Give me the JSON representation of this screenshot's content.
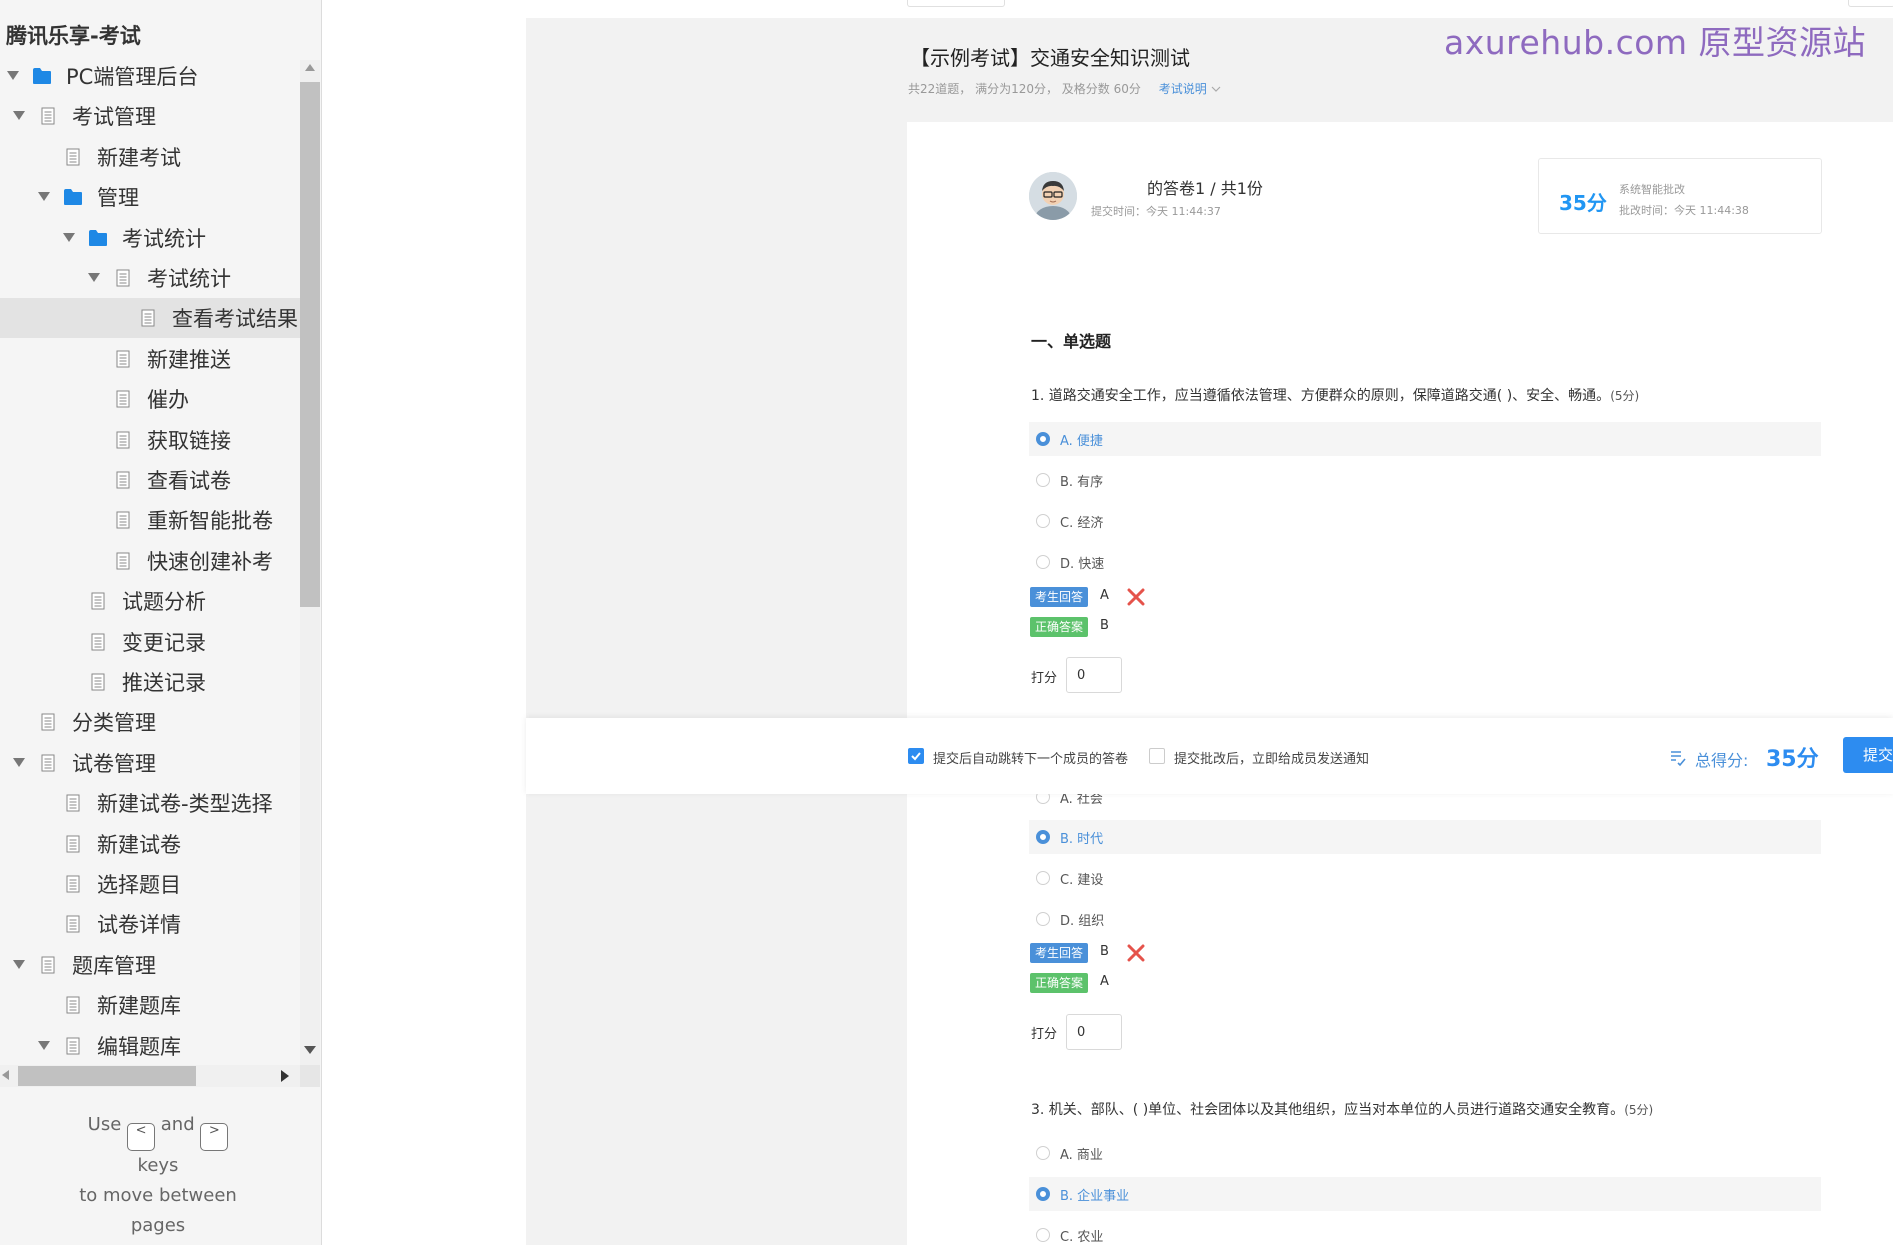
{
  "sidebar": {
    "title": "腾讯乐享-考试",
    "tree": [
      {
        "label": "PC端管理后台",
        "level": 0,
        "type": "folder",
        "expanded": true
      },
      {
        "label": "考试管理",
        "level": 1,
        "type": "page",
        "expanded": true
      },
      {
        "label": "新建考试",
        "level": 2,
        "type": "page"
      },
      {
        "label": "管理",
        "level": 2,
        "type": "folder",
        "expanded": true
      },
      {
        "label": "考试统计",
        "level": 3,
        "type": "folder",
        "expanded": true
      },
      {
        "label": "考试统计",
        "level": 4,
        "type": "page",
        "expanded": true
      },
      {
        "label": "查看考试结果",
        "level": 5,
        "type": "page",
        "selected": true
      },
      {
        "label": "新建推送",
        "level": 4,
        "type": "page"
      },
      {
        "label": "催办",
        "level": 4,
        "type": "page"
      },
      {
        "label": "获取链接",
        "level": 4,
        "type": "page"
      },
      {
        "label": "查看试卷",
        "level": 4,
        "type": "page"
      },
      {
        "label": "重新智能批卷",
        "level": 4,
        "type": "page"
      },
      {
        "label": "快速创建补考",
        "level": 4,
        "type": "page"
      },
      {
        "label": "试题分析",
        "level": 3,
        "type": "page"
      },
      {
        "label": "变更记录",
        "level": 3,
        "type": "page"
      },
      {
        "label": "推送记录",
        "level": 3,
        "type": "page"
      },
      {
        "label": "分类管理",
        "level": 1,
        "type": "page"
      },
      {
        "label": "试卷管理",
        "level": 1,
        "type": "page",
        "expanded": true
      },
      {
        "label": "新建试卷-类型选择",
        "level": 2,
        "type": "page"
      },
      {
        "label": "新建试卷",
        "level": 2,
        "type": "page"
      },
      {
        "label": "选择题目",
        "level": 2,
        "type": "page"
      },
      {
        "label": "试卷详情",
        "level": 2,
        "type": "page"
      },
      {
        "label": "题库管理",
        "level": 1,
        "type": "page",
        "expanded": true
      },
      {
        "label": "新建题库",
        "level": 2,
        "type": "page"
      },
      {
        "label": "编辑题库",
        "level": 2,
        "type": "page",
        "expanded": true
      }
    ],
    "help": {
      "use": "Use",
      "key_prev": "<",
      "and": "and",
      "key_next": ">",
      "keys": "keys",
      "line2": "to move between",
      "line3": "pages"
    }
  },
  "watermark": "axurehub.com 原型资源站",
  "exam": {
    "title": "【示例考试】交通安全知识测试",
    "meta": "共22道题， 满分为120分， 及格分数 60分",
    "info_link": "考试说明",
    "sheet_title": "的答卷1 / 共1份",
    "submit_time": "提交时间：今天 11:44:37",
    "score": "35分",
    "grade_method": "系统智能批改",
    "grade_time": "批改时间：今天 11:44:38"
  },
  "section_title": "一、单选题",
  "labels": {
    "student_answer": "考生回答",
    "correct_answer": "正确答案",
    "score": "打分"
  },
  "questions": [
    {
      "text": "1. 道路交通安全工作，应当遵循依法管理、方便群众的原则，保障道路交通(  )、安全、畅通。",
      "points": "(5分)",
      "options": [
        {
          "label": "A. 便捷",
          "selected": true
        },
        {
          "label": "B. 有序",
          "selected": false
        },
        {
          "label": "C. 经济",
          "selected": false
        },
        {
          "label": "D. 快速",
          "selected": false
        }
      ],
      "student_answer": "A",
      "correct_answer": "B",
      "score_value": "0"
    },
    {
      "options": [
        {
          "label": "A. 社会",
          "selected": false
        },
        {
          "label": "B. 时代",
          "selected": true
        },
        {
          "label": "C. 建设",
          "selected": false
        },
        {
          "label": "D. 组织",
          "selected": false
        }
      ],
      "student_answer": "B",
      "correct_answer": "A",
      "score_value": "0"
    },
    {
      "text": "3. 机关、部队、(  )单位、社会团体以及其他组织，应当对本单位的人员进行道路交通安全教育。",
      "points": "(5分)",
      "options": [
        {
          "label": "A. 商业",
          "selected": false
        },
        {
          "label": "B. 企业事业",
          "selected": true
        },
        {
          "label": "C. 农业",
          "selected": false
        }
      ]
    }
  ],
  "bottom_bar": {
    "auto_next_label": "提交后自动跳转下一个成员的答卷",
    "auto_next_checked": true,
    "notify_label": "提交批改后，立即给成员发送通知",
    "notify_checked": false,
    "total_label": "总得分:",
    "total_value": "35分",
    "submit_label": "提交"
  },
  "colors": {
    "accent": "#2d8cf0",
    "correct_tag": "#5cc26b",
    "wrong_mark": "#e5534b",
    "watermark": "#8e6abf"
  }
}
